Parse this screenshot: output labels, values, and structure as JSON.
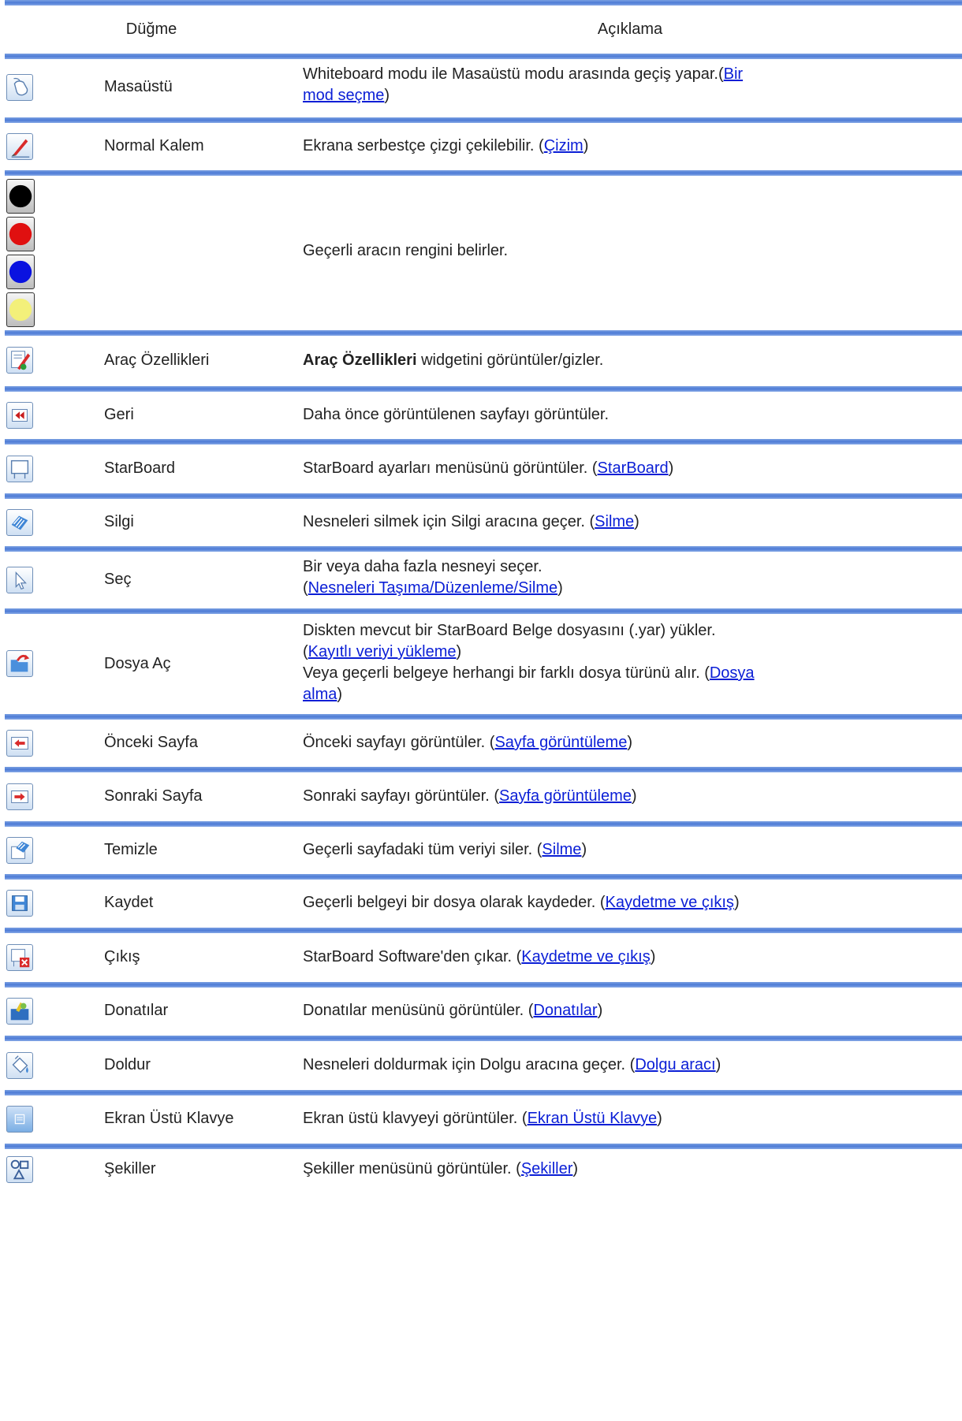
{
  "header": {
    "col_button": "Düğme",
    "col_desc": "Açıklama"
  },
  "colors": {
    "separator": "#4d7bd6",
    "link": "#0a1ed6",
    "swatches": [
      "#000000",
      "#e01010",
      "#0a12e0",
      "#f3f07a"
    ]
  },
  "rows": [
    {
      "icon": "mouse-icon",
      "name": "Masaüstü",
      "d0": "Whiteboard modu ile Masaüstü modu arasında geçiş yapar.(",
      "l0": "Bir",
      "d1": "",
      "l1": "mod seçme",
      "d2": ")"
    },
    {
      "icon": "pen-icon",
      "name": "Normal Kalem",
      "d0": "Ekrana serbestçe çizgi çekilebilir. (",
      "l0": "Çizim",
      "d1": ")"
    },
    {
      "icon": "color-swatches",
      "name": "",
      "d0": "Geçerli aracın rengini belirler."
    },
    {
      "icon": "tool-properties-icon",
      "name": "Araç Özellikleri",
      "b0": "Araç Özellikleri",
      "d0": " widgetini görüntüler/gizler."
    },
    {
      "icon": "rewind-icon",
      "name": "Geri",
      "d0": "Daha önce görüntülenen sayfayı görüntüler."
    },
    {
      "icon": "starboard-icon",
      "name": "StarBoard",
      "d0": "StarBoard ayarları menüsünü görüntüler. (",
      "l0": "StarBoard",
      "d1": ")"
    },
    {
      "icon": "eraser-icon",
      "name": "Silgi",
      "d0": "Nesneleri silmek için Silgi aracına geçer. (",
      "l0": "Silme",
      "d1": ")"
    },
    {
      "icon": "select-arrow-icon",
      "name": "Seç",
      "d0": "Bir veya daha fazla nesneyi seçer.",
      "d1": "(",
      "l0": "Nesneleri Taşıma/Düzenleme/Silme",
      "d2": ")"
    },
    {
      "icon": "open-folder-icon",
      "name": "Dosya Aç",
      "d0": "Diskten mevcut bir StarBoard Belge dosyasını (.yar) yükler.",
      "d1": "(",
      "l0": "Kayıtlı veriyi yükleme",
      "d2": ")",
      "d3": "Veya geçerli belgeye herhangi bir farklı dosya türünü alır. (",
      "l1": "Dosya",
      "l2": "alma",
      "d4": ")"
    },
    {
      "icon": "prev-page-icon",
      "name": "Önceki Sayfa",
      "d0": "Önceki sayfayı görüntüler. (",
      "l0": "Sayfa görüntüleme",
      "d1": ")"
    },
    {
      "icon": "next-page-icon",
      "name": "Sonraki Sayfa",
      "d0": "Sonraki sayfayı görüntüler. (",
      "l0": "Sayfa görüntüleme",
      "d1": ")"
    },
    {
      "icon": "clear-icon",
      "name": "Temizle",
      "d0": "Geçerli sayfadaki tüm veriyi siler. (",
      "l0": "Silme",
      "d1": ")"
    },
    {
      "icon": "save-icon",
      "name": "Kaydet",
      "d0": "Geçerli belgeyi bir dosya olarak kaydeder. (",
      "l0": "Kaydetme ve çıkış",
      "d1": ")"
    },
    {
      "icon": "exit-icon",
      "name": "Çıkış",
      "d0": "StarBoard Software'den çıkar. (",
      "l0": "Kaydetme ve çıkış",
      "d1": ")"
    },
    {
      "icon": "accessories-icon",
      "name": "Donatılar",
      "d0": "Donatılar menüsünü görüntüler. (",
      "l0": "Donatılar",
      "d1": ")"
    },
    {
      "icon": "fill-bucket-icon",
      "name": "Doldur",
      "d0": "Nesneleri doldurmak için Dolgu aracına geçer. (",
      "l0": "Dolgu aracı",
      "d1": ")"
    },
    {
      "icon": "keyboard-icon",
      "name": "Ekran Üstü Klavye",
      "d0": "Ekran üstü klavyeyi görüntüler. (",
      "l0": "Ekran Üstü Klavye",
      "d1": ")"
    },
    {
      "icon": "shapes-icon",
      "name": "Şekiller",
      "d0": "Şekiller menüsünü görüntüler. (",
      "l0": "Şekiller",
      "d1": ")"
    }
  ]
}
